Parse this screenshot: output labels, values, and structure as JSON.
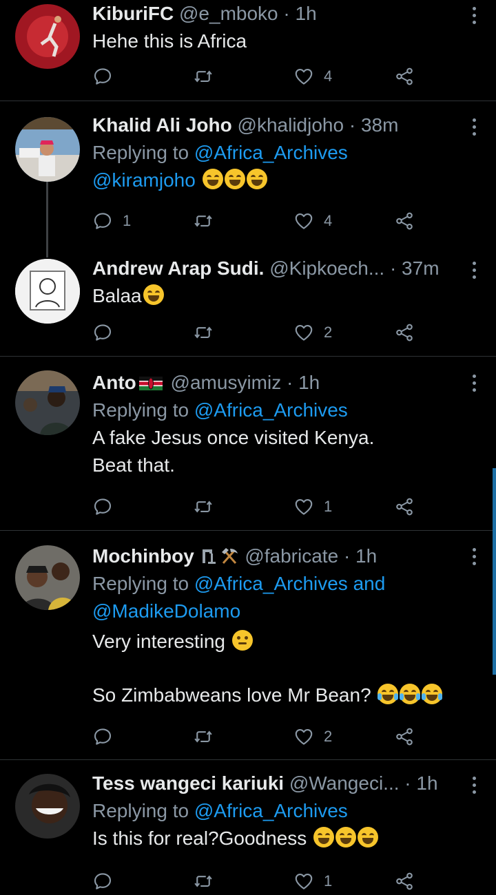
{
  "tweets": [
    {
      "name": "KiburiFC",
      "handle": "@e_mboko",
      "time": "· 1h",
      "replying": null,
      "body": [
        "Hehe this is Africa"
      ],
      "replies": "",
      "retweets": "",
      "likes": "4"
    },
    {
      "name": "Khalid Ali Joho",
      "handle": "@khalidjoho",
      "time": "· 38m",
      "replying_prefix": "Replying to",
      "replying_to": "@Africa_Archives",
      "body_link": "@kiramjoho",
      "replies": "1",
      "retweets": "",
      "likes": "4"
    },
    {
      "name": "Andrew Arap Sudi.",
      "handle": "@Kipkoech...",
      "time": "· 37m",
      "body": [
        "Balaa"
      ],
      "replies": "",
      "retweets": "",
      "likes": "2"
    },
    {
      "name": "Anto",
      "handle": "@amusyimiz",
      "time": "· 1h",
      "replying_prefix": "Replying to",
      "replying_to": "@Africa_Archives",
      "body": [
        "A fake Jesus once visited Kenya.",
        "Beat that."
      ],
      "replies": "",
      "retweets": "",
      "likes": "1"
    },
    {
      "name": "Mochinboy",
      "handle": "@fabricate",
      "time": "· 1h",
      "replying_prefix": "Replying to",
      "replying_to": "@Africa_Archives and",
      "replying_to_2": "@MadikeDolamo",
      "body": [
        "Very interesting",
        "So Zimbabweans love Mr Bean?"
      ],
      "replies": "",
      "retweets": "",
      "likes": "2"
    },
    {
      "name": "Tess wangeci kariuki",
      "handle": "@Wangeci...",
      "time": "· 1h",
      "replying_prefix": "Replying to",
      "replying_to": "@Africa_Archives",
      "body": [
        "Is this for real?Goodness"
      ],
      "replies": "",
      "retweets": "",
      "likes": "1"
    }
  ],
  "colors": {
    "background": "#000000",
    "text": "#e7e9ea",
    "secondary": "#8b98a5",
    "link": "#1d9bf0",
    "divider": "#2f3336"
  },
  "icons": {
    "reply": "reply-icon",
    "retweet": "retweet-icon",
    "like": "heart-icon",
    "share": "share-icon",
    "more": "more-vertical-icon"
  }
}
